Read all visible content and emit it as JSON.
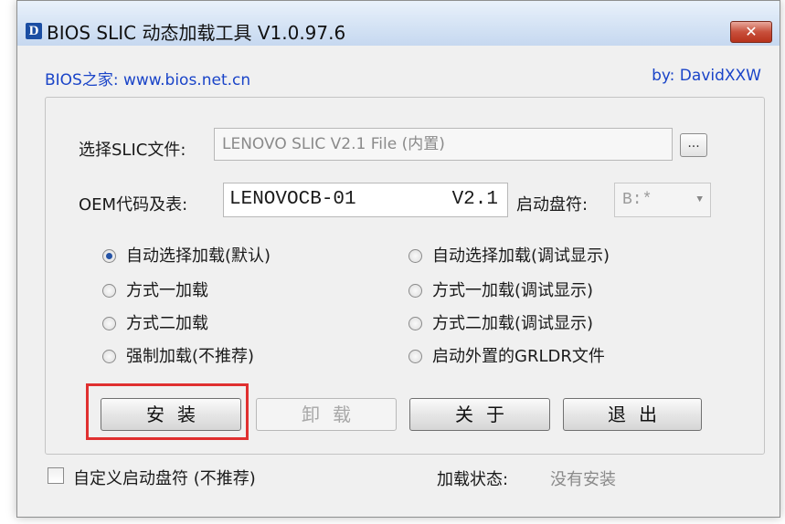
{
  "window": {
    "icon_letter": "D",
    "title": "BIOS SLIC 动态加载工具 V1.0.97.6",
    "close_label": "✕"
  },
  "header": {
    "home_link": "BIOS之家: www.bios.net.cn",
    "author": "by: DavidXXW"
  },
  "slic": {
    "label": "选择SLIC文件:",
    "value": "LENOVO SLIC V2.1 File (内置)",
    "browse_label": "..."
  },
  "oem": {
    "label": "OEM代码及表:",
    "code": "LENOVOCB-01",
    "version": "V2.1"
  },
  "boot_drive": {
    "label": "启动盘符:",
    "value": "B:*",
    "arrow": "▼"
  },
  "load_modes": [
    {
      "label": "自动选择加载(默认)",
      "checked": true
    },
    {
      "label": "自动选择加载(调试显示)",
      "checked": false
    },
    {
      "label": "方式一加载",
      "checked": false
    },
    {
      "label": "方式一加载(调试显示)",
      "checked": false
    },
    {
      "label": "方式二加载",
      "checked": false
    },
    {
      "label": "方式二加载(调试显示)",
      "checked": false
    },
    {
      "label": "强制加载(不推荐)",
      "checked": false
    },
    {
      "label": "启动外置的GRLDR文件",
      "checked": false
    }
  ],
  "buttons": {
    "install": "安装",
    "uninstall": "卸载",
    "about": "关于",
    "exit": "退出"
  },
  "footer": {
    "custom_drive_label": "自定义启动盘符 (不推荐)",
    "custom_drive_checked": false,
    "status_label": "加载状态:",
    "status_value": "没有安装"
  },
  "colors": {
    "link": "#1a44c8",
    "highlight_box": "#e03030",
    "radio_selected": "#2553a5"
  }
}
